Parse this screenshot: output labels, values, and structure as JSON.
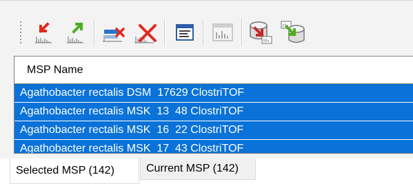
{
  "toolbar": {
    "buttons": [
      {
        "name": "export-red-icon",
        "group": 1
      },
      {
        "name": "import-green-icon",
        "group": 1
      },
      {
        "name": "clear-selection-icon",
        "group": 2
      },
      {
        "name": "delete-profile-icon",
        "group": 2
      },
      {
        "name": "properties-icon",
        "group": 3
      },
      {
        "name": "chart-disabled-icon",
        "group": 4
      },
      {
        "name": "database-red-export-icon",
        "group": 5
      },
      {
        "name": "database-green-import-icon",
        "group": 5
      }
    ]
  },
  "grid": {
    "header": "MSP Name",
    "rows": [
      "Agathobacter rectalis DSM  17629 ClostriTOF",
      "Agathobacter rectalis MSK  13  48 ClostriTOF",
      "Agathobacter rectalis MSK  16  22 ClostriTOF",
      "Agathobacter rectalis MSK  17  43 ClostriTOF"
    ],
    "selection_color": "#0a72d8"
  },
  "tabs": {
    "selected": "Selected MSP (142)",
    "current": "Current MSP (142)"
  }
}
